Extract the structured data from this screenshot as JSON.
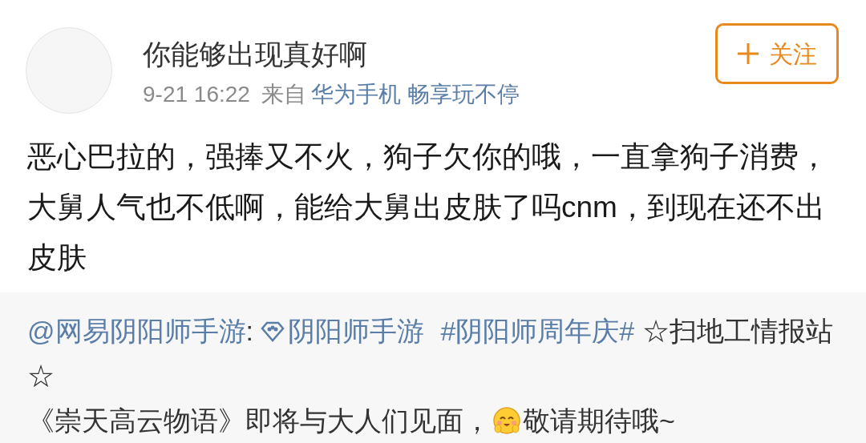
{
  "post": {
    "author": "你能够出现真好啊",
    "time": "9-21 16:22",
    "source_label": "来自",
    "source": "华为手机 畅享玩不停",
    "follow_button": "关注",
    "body": "恶心巴拉的，强捧又不火，狗子欠你的哦，一直拿狗子消费，大舅人气也不低啊，能给大舅出皮肤了吗cnm，到现在还不出皮肤"
  },
  "repost": {
    "paragraphs": [
      [
        {
          "kind": "mention",
          "text": "@网易阴阳师手游"
        },
        {
          "kind": "text",
          "text": ": "
        },
        {
          "kind": "badge_link",
          "text": "阴阳师手游"
        },
        {
          "kind": "topic",
          "text": "#阴阳师周年庆#"
        },
        {
          "kind": "text",
          "text": " ☆扫地工情报站☆"
        }
      ],
      [
        {
          "kind": "text",
          "text": "《崇天高云物语》即将与大人们见面，"
        },
        {
          "kind": "emoji"
        },
        {
          "kind": "text",
          "text": "敬请期待哦~"
        }
      ]
    ]
  }
}
